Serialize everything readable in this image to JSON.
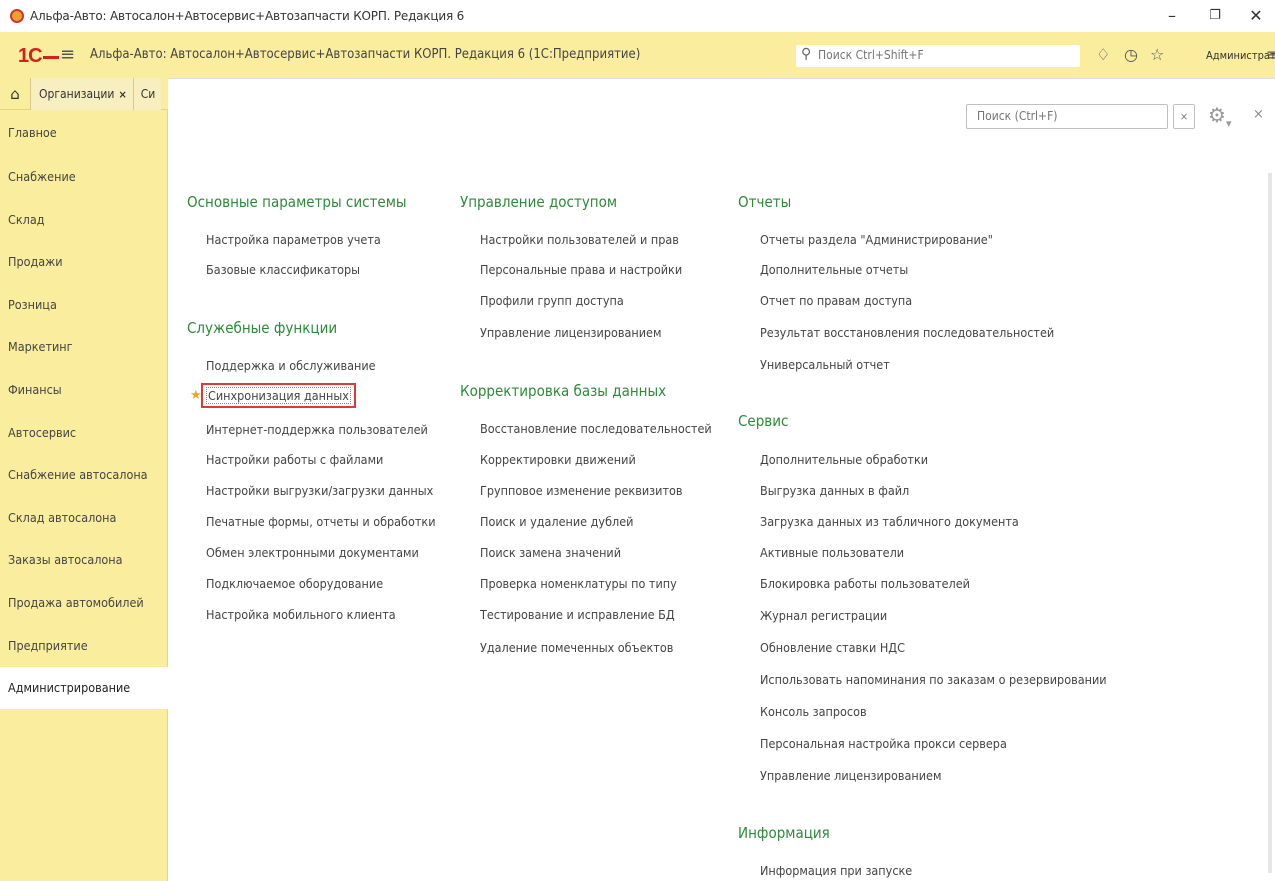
{
  "window": {
    "title": "Альфа-Авто: Автосалон+Автосервис+Автозапчасти КОРП. Редакция 6",
    "minimize_icon": "minimize-icon",
    "maximize_icon": "restore-icon",
    "close_icon": "close-icon"
  },
  "toolbar": {
    "logo": "1С",
    "app_title": "Альфа-Авто: Автосалон+Автосервис+Автозапчасти КОРП. Редакция 6  (1С:Предприятие)",
    "search_placeholder": "Поиск Ctrl+Shift+F",
    "user": "Администратор",
    "colors": {
      "bar": "#fbed9e",
      "logo_red": "#d2211d"
    }
  },
  "tabs": {
    "items": [
      {
        "label": "Организации"
      },
      {
        "label": "Си"
      }
    ]
  },
  "sidebar": {
    "items": [
      {
        "label": "Главное"
      },
      {
        "label": "Снабжение"
      },
      {
        "label": "Склад"
      },
      {
        "label": "Продажи"
      },
      {
        "label": "Розница"
      },
      {
        "label": "Маркетинг"
      },
      {
        "label": "Финансы"
      },
      {
        "label": "Автосервис"
      },
      {
        "label": "Снабжение автосалона"
      },
      {
        "label": "Склад автосалона"
      },
      {
        "label": "Заказы автосалона"
      },
      {
        "label": "Продажа автомобилей"
      },
      {
        "label": "Предприятие"
      },
      {
        "label": "Администрирование",
        "active": true
      }
    ]
  },
  "content": {
    "find_placeholder": "Поиск (Ctrl+F)",
    "clear_label": "×",
    "close_label": "×",
    "section_color": "#2e8a3a",
    "col1": {
      "s1": {
        "title": "Основные параметры системы",
        "links": [
          "Настройка параметров учета",
          "Базовые классификаторы"
        ]
      },
      "s2": {
        "title": "Служебные функции",
        "links": [
          "Поддержка и обслуживание",
          "Синхронизация данных",
          "Интернет-поддержка пользователей",
          "Настройки работы с файлами",
          "Настройки выгрузки/загрузки данных",
          "Печатные формы, отчеты и обработки",
          "Обмен электронными документами",
          "Подключаемое оборудование",
          "Настройка мобильного клиента"
        ]
      }
    },
    "col2": {
      "s1": {
        "title": "Управление доступом",
        "links": [
          "Настройки пользователей и прав",
          "Персональные права и настройки",
          "Профили групп доступа",
          "Управление лицензированием"
        ]
      },
      "s2": {
        "title": "Корректировка базы данных",
        "links": [
          "Восстановление последовательностей",
          "Корректировки движений",
          "Групповое изменение реквизитов",
          "Поиск и удаление дублей",
          "Поиск замена значений",
          "Проверка номенклатуры по типу",
          "Тестирование и исправление БД",
          "Удаление помеченных объектов"
        ]
      }
    },
    "col3": {
      "s1": {
        "title": "Отчеты",
        "links": [
          "Отчеты раздела \"Администрирование\"",
          "Дополнительные отчеты",
          "Отчет по правам доступа",
          "Результат восстановления последовательностей",
          "Универсальный отчет"
        ]
      },
      "s2": {
        "title": "Сервис",
        "links": [
          "Дополнительные обработки",
          "Выгрузка данных в файл",
          "Загрузка данных из табличного документа",
          "Активные пользователи",
          "Блокировка работы пользователей",
          "Журнал регистрации",
          "Обновление ставки НДС",
          "Использовать напоминания по заказам о резервировании",
          "Консоль запросов",
          "Персональная настройка прокси сервера",
          "Управление лицензированием"
        ]
      },
      "s3": {
        "title": "Информация",
        "links": [
          "Информация при запуске"
        ]
      }
    }
  }
}
